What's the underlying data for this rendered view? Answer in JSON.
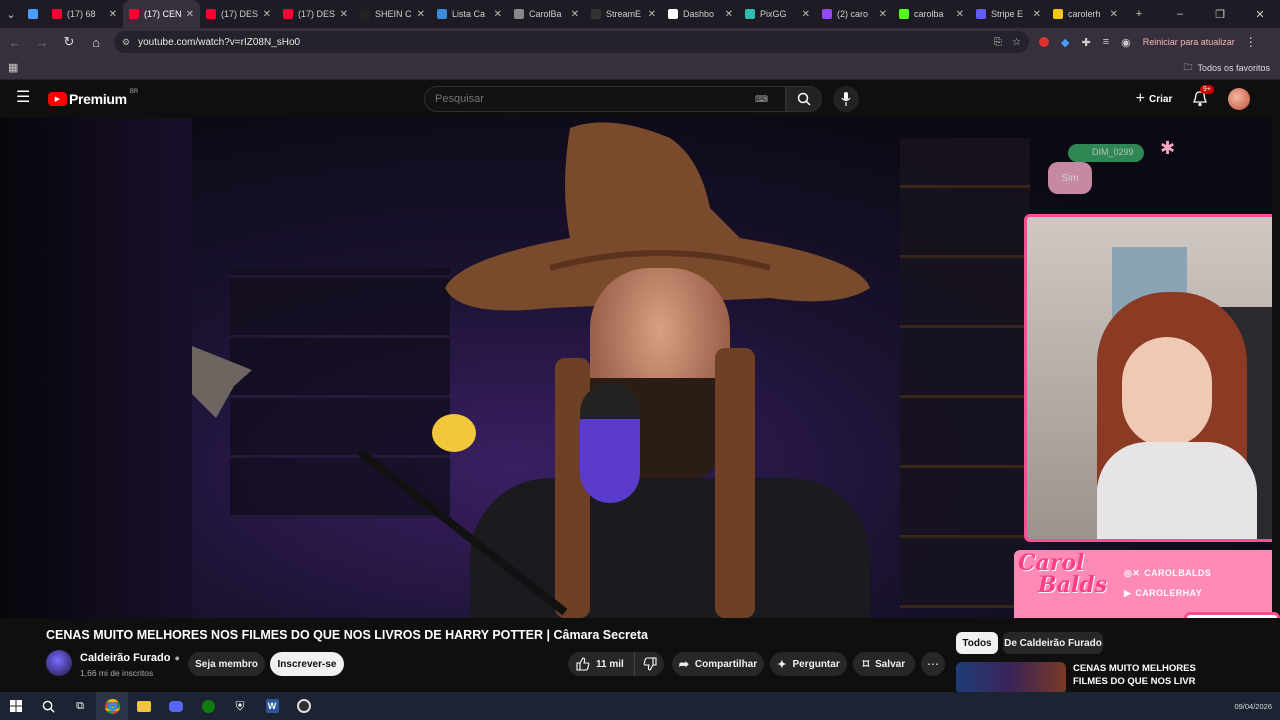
{
  "browser": {
    "tabs": [
      {
        "title": "",
        "fav": "#4aa0ff"
      },
      {
        "title": "(17) 68",
        "fav": "#ff0033"
      },
      {
        "title": "(17) CEN",
        "fav": "#ff0033",
        "active": true
      },
      {
        "title": "(17) DES",
        "fav": "#ff0033"
      },
      {
        "title": "(17) DES",
        "fav": "#ff0033"
      },
      {
        "title": "SHEIN C",
        "fav": "#222222"
      },
      {
        "title": "Lista Ca",
        "fav": "#3d8bd9"
      },
      {
        "title": "CarolBa",
        "fav": "#888888"
      },
      {
        "title": "StreamE",
        "fav": "#333333"
      },
      {
        "title": "Dashbo",
        "fav": "#ffffff"
      },
      {
        "title": "PixGG",
        "fav": "#32bcad"
      },
      {
        "title": "(2) caro",
        "fav": "#9146ff"
      },
      {
        "title": "carolba",
        "fav": "#53fc18"
      },
      {
        "title": "Stripe E",
        "fav": "#635bff"
      },
      {
        "title": "carolerh",
        "fav": "#f5c518"
      }
    ],
    "url": "youtube.com/watch?v=rIZ08N_sHo0",
    "restart_label": "Reiniciar para atualizar",
    "bookmarks_label": "Todos os favoritos"
  },
  "youtube": {
    "logo_text": "Premium",
    "logo_badge": "BR",
    "search_placeholder": "Pesquisar",
    "create_label": "Criar",
    "notif_count": "9+"
  },
  "stream_overlay": {
    "chat_user": "DIM_0299",
    "chat_reply": "Sim",
    "logo_line1": "Carol",
    "logo_line2": "Balds",
    "social1": "CAROLBALDS",
    "social2": "CAROLERHAY"
  },
  "video": {
    "title": "CENAS MUITO MELHORES NOS FILMES DO QUE NOS LIVROS DE HARRY POTTER | Câmara Secreta",
    "channel": "Caldeirão Furado",
    "subscribers": "1,66 mi de inscritos",
    "join_label": "Seja membro",
    "subscribe_label": "Inscrever-se",
    "likes": "11 mil",
    "share_label": "Compartilhar",
    "ask_label": "Perguntar",
    "save_label": "Salvar"
  },
  "sidebar": {
    "chips": [
      "Todos",
      "De Caldeirão Furado"
    ],
    "rec_title_line1": "CENAS MUITO MELHORES",
    "rec_title_line2": "FILMES DO QUE NOS LIVR"
  },
  "taskbar": {
    "date": "09/04/2026"
  }
}
